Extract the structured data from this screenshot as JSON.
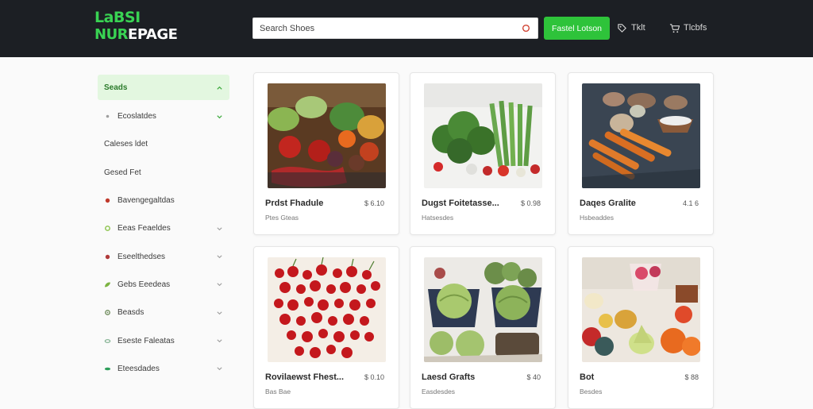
{
  "header": {
    "logo_line1": "LaBSI",
    "logo_line2_green": "NUR",
    "logo_line2_white": "EPAGE",
    "search_placeholder": "Search Shoes",
    "search_button": "Fastel Lotson",
    "links": [
      {
        "label": "Tklt",
        "icon": "tag-icon"
      },
      {
        "label": "Tlcbfs",
        "icon": "cart-icon"
      }
    ]
  },
  "sidebar": {
    "items": [
      {
        "label": "Seads",
        "active": true,
        "chevron": "up",
        "color": ""
      },
      {
        "label": "Ecoslatdes",
        "active": false,
        "chevron": "down",
        "color": "#9e9e9e"
      },
      {
        "label": "Caleses ldet",
        "active": false,
        "chevron": "",
        "color": ""
      },
      {
        "label": "Gesed Fet",
        "active": false,
        "chevron": "",
        "color": ""
      },
      {
        "label": "Bavengegaltdas",
        "active": false,
        "chevron": "",
        "color": "#c0392b"
      },
      {
        "label": "Eeas Feaeldes",
        "active": false,
        "chevron": "down",
        "color": "#8bc34a"
      },
      {
        "label": "Eseelthedses",
        "active": false,
        "chevron": "down",
        "color": "#b03a3a"
      },
      {
        "label": "Gebs Eeedeas",
        "active": false,
        "chevron": "down",
        "color": "#7cb342"
      },
      {
        "label": "Beasds",
        "active": false,
        "chevron": "down",
        "color": "#6d8a5a"
      },
      {
        "label": "Eseste Faleatas",
        "active": false,
        "chevron": "down",
        "color": "#7faf8f"
      },
      {
        "label": "Eteesdades",
        "active": false,
        "chevron": "down",
        "color": "#2e9e5a"
      }
    ]
  },
  "products": [
    {
      "title": "Prdst Fhadule",
      "price": "$ 6.10",
      "sub": "Ptes Gteas",
      "image": "mixed-vegetables"
    },
    {
      "title": "Dugst Foitetasse...",
      "price": "$ 0.98",
      "sub": "Hatsesdes",
      "image": "broccoli-asparagus"
    },
    {
      "title": "Daqes Gralite",
      "price": "4.1 6",
      "sub": "Hsbeaddes",
      "image": "carrots-root-veg"
    },
    {
      "title": "Rovilaewst Fhest...",
      "price": "$ 0.10",
      "sub": "Bas Bae",
      "image": "cherries"
    },
    {
      "title": "Laesd Grafts",
      "price": "$ 40",
      "sub": "Easdesdes",
      "image": "cabbage-lettuce"
    },
    {
      "title": "Bot",
      "price": "$ 88",
      "sub": "Besdes",
      "image": "produce-assortment"
    }
  ],
  "colors": {
    "topbar": "#1c1f24",
    "accent_green": "#2ec33a",
    "sidebar_active_bg": "#e3f7e0"
  }
}
